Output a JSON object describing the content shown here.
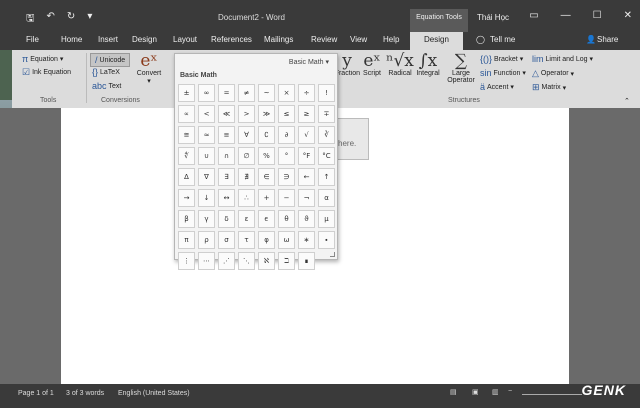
{
  "titlebar": {
    "save_icon": "save-icon",
    "undo_icon": "undo-icon",
    "redo_icon": "redo-icon",
    "title": "Document2 - Word",
    "context_group": "Equation Tools",
    "user": "Thái Học"
  },
  "tabs": [
    "File",
    "Home",
    "Insert",
    "Design",
    "Layout",
    "References",
    "Mailings",
    "Review",
    "View",
    "Help",
    "Design"
  ],
  "tell_me": "Tell me",
  "share": "Share",
  "ribbon": {
    "equation": "Equation",
    "ink_equation": "Ink Equation",
    "tools_label": "Tools",
    "unicode": "Unicode",
    "latex": "LaTeX",
    "text": "Text",
    "convert": "Convert",
    "conversions_label": "Conversions",
    "fraction": "Fraction",
    "script": "Script",
    "radical": "Radical",
    "integral": "Integral",
    "large_operator": "Large Operator",
    "bracket": "Bracket",
    "function": "Function",
    "accent": "Accent",
    "limit_log": "Limit and Log",
    "operator": "Operator",
    "matrix": "Matrix",
    "structures_label": "Structures"
  },
  "dropdown": {
    "header": "Basic Math",
    "category": "Basic Math",
    "symbols": [
      "±",
      "∞",
      "=",
      "≠",
      "~",
      "×",
      "÷",
      "!",
      "∝",
      "<",
      "≪",
      ">",
      "≫",
      "≤",
      "≥",
      "∓",
      "≅",
      "≈",
      "≡",
      "∀",
      "∁",
      "∂",
      "√",
      "∛",
      "∜",
      "∪",
      "∩",
      "∅",
      "%",
      "°",
      "°F",
      "°C",
      "∆",
      "∇",
      "∃",
      "∄",
      "∈",
      "∋",
      "←",
      "↑",
      "→",
      "↓",
      "↔",
      "∴",
      "+",
      "−",
      "¬",
      "α",
      "β",
      "γ",
      "δ",
      "ε",
      "ϵ",
      "θ",
      "ϑ",
      "μ",
      "π",
      "ρ",
      "σ",
      "τ",
      "φ",
      "ω",
      "∗",
      "∙",
      "⋮",
      "⋯",
      "⋰",
      "⋱",
      "ℵ",
      "ℶ",
      "∎"
    ]
  },
  "eq_placeholder": "here.",
  "status": {
    "page": "Page 1 of 1",
    "words": "3 of 3 words",
    "language": "English (United States)"
  },
  "watermark": "GENK"
}
